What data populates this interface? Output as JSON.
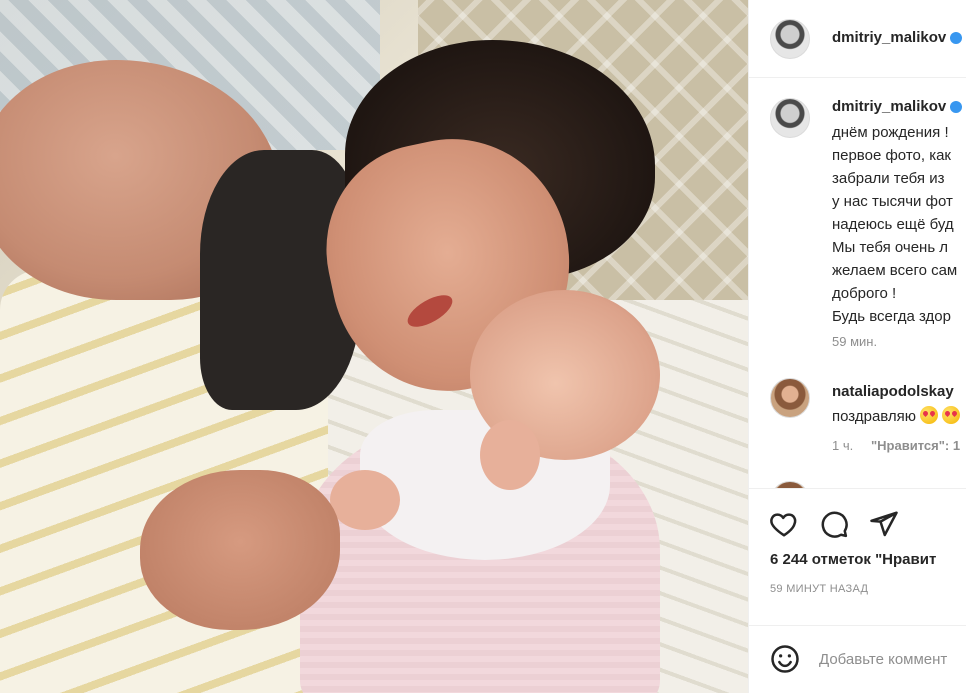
{
  "post": {
    "author": "dmitriy_malikov",
    "verified": true,
    "photo_alt": "photo-of-man-and-baby"
  },
  "caption": {
    "author": "dmitriy_malikov",
    "lines": [
      "днём рождения !",
      "первое фото, как",
      "забрали тебя из",
      "у нас тысячи фот",
      "надеюсь ещё буд",
      "Мы тебя очень л",
      "желаем всего сам",
      "доброго !",
      "Будь всегда здор"
    ],
    "time": "59 мин."
  },
  "comments": [
    {
      "author": "nataliapodolskay",
      "text": "поздравляю",
      "emoji": "heart-eyes-emoji",
      "time": "1 ч.",
      "likes": "\"Нравится\": 1"
    }
  ],
  "actions": {
    "likes": "6 244 отметок \"Нравит",
    "timestamp": "59 МИНУТ НАЗАД"
  },
  "add_comment": {
    "placeholder": "Добавьте коммент"
  },
  "colors": {
    "verified": "#3897f0",
    "text": "#262626",
    "muted": "#8e8e8e",
    "divider": "#efefef"
  }
}
